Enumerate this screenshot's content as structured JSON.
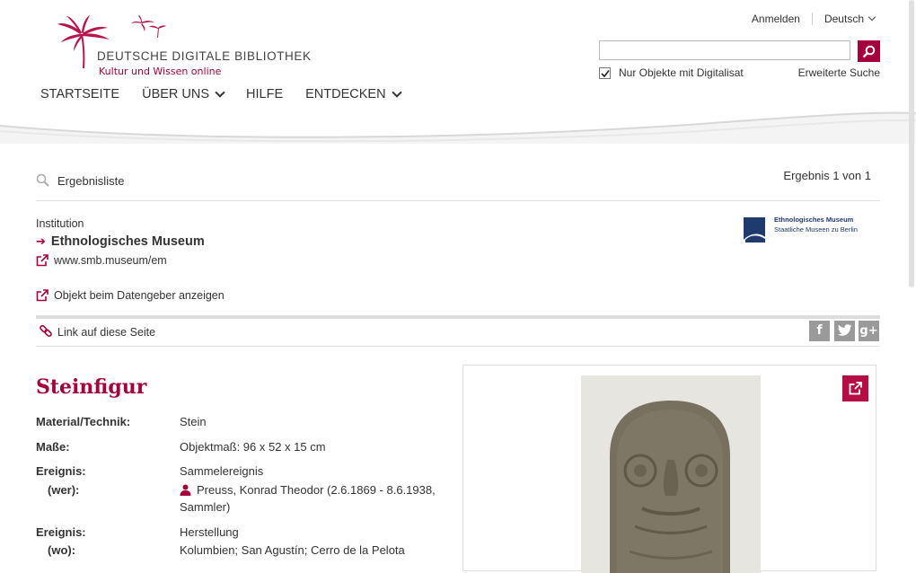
{
  "header": {
    "logo_title": "DEUTSCHE DIGITALE BIBLIOTHEK",
    "logo_subtitle": "Kultur und Wissen online",
    "login_label": "Anmelden",
    "language_label": "Deutsch",
    "search": {
      "placeholder": "",
      "value": ""
    },
    "digitalisat_label": "Nur Objekte mit Digitalisat",
    "digitalisat_checked": true,
    "advanced_search_label": "Erweiterte Suche",
    "nav": [
      {
        "label": "STARTSEITE",
        "has_dropdown": false
      },
      {
        "label": "ÜBER UNS",
        "has_dropdown": true
      },
      {
        "label": "HILFE",
        "has_dropdown": false
      },
      {
        "label": "ENTDECKEN",
        "has_dropdown": true
      }
    ]
  },
  "results": {
    "list_label": "Ergebnisliste",
    "count_label": "Ergebnis 1 von 1"
  },
  "institution": {
    "label": "Institution",
    "name": "Ethnologisches Museum",
    "url": "www.smb.museum/em",
    "logo_line1": "Ethnologisches Museum",
    "logo_line2": "Staatliche Museen zu Berlin"
  },
  "actions": {
    "show_at_provider": "Objekt beim Datengeber anzeigen",
    "page_link": "Link auf diese Seite",
    "social": [
      "f",
      "t",
      "g+"
    ]
  },
  "object": {
    "title": "Steinfigur",
    "fields": [
      {
        "key": "Material/Technik:",
        "value": "Stein"
      },
      {
        "key": "Maße:",
        "value": "Objektmaß: 96 x 52 x 15 cm"
      },
      {
        "key": "Ereignis:",
        "value": "Sammelereignis"
      },
      {
        "key": "(wer):",
        "value": "Preuss, Konrad Theodor (2.6.1869 - 8.6.1938,",
        "value2": "Sammler)"
      },
      {
        "key": "Ereignis:",
        "value": "Herstellung"
      },
      {
        "key": "(wo):",
        "value": "Kolumbien; San Agustín; Cerro de la Pelota"
      }
    ]
  },
  "colors": {
    "accent": "#a5003b",
    "text": "#333333",
    "social": "#9a9a9a"
  },
  "icons": {
    "search": "magnifier-icon",
    "external": "external-link-icon",
    "person": "person-icon",
    "chain": "chain-link-icon",
    "fullscreen": "fullscreen-icon"
  }
}
